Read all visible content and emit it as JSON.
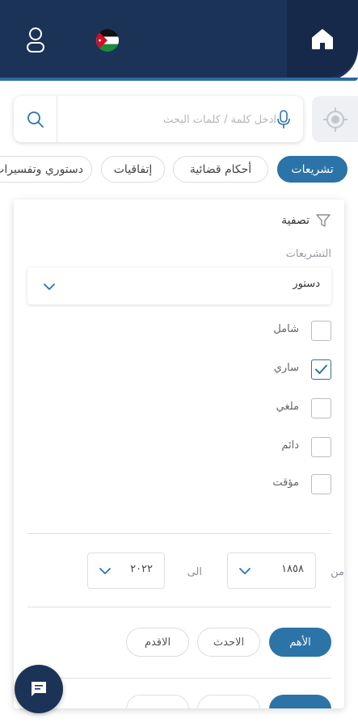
{
  "header": {
    "home_icon": "home-icon",
    "user_icon": "user-icon",
    "flag_icon": "jordan-flag-icon"
  },
  "search": {
    "placeholder": "ادخل كلمة / كلمات البحث",
    "search_icon": "search-icon",
    "mic_icon": "microphone-icon",
    "locate_icon": "crosshair-icon"
  },
  "categories": [
    {
      "label": "تشريعات",
      "active": true
    },
    {
      "label": "أحكام قضائية",
      "active": false
    },
    {
      "label": "إتفاقيات",
      "active": false
    },
    {
      "label": "دستوري وتفسيرات",
      "active": false
    }
  ],
  "filter": {
    "title": "تصفية",
    "type_label": "التشريعات",
    "type_value": "دستور",
    "statuses": [
      {
        "label": "شامل",
        "checked": false
      },
      {
        "label": "ساري",
        "checked": true
      },
      {
        "label": "ملغي",
        "checked": false
      },
      {
        "label": "دائم",
        "checked": false
      },
      {
        "label": "مؤقت",
        "checked": false
      }
    ],
    "range": {
      "from_label": "من",
      "from_value": "١٨٥٨",
      "to_label": "الى",
      "to_value": "٢٠٢٢"
    },
    "sort": [
      {
        "label": "الأهم",
        "active": true
      },
      {
        "label": "الاحدث",
        "active": false
      },
      {
        "label": "الاقدم",
        "active": false
      }
    ]
  },
  "colors": {
    "header": "#1b3357",
    "accent": "#2c73a8"
  },
  "chat_icon": "chat-icon"
}
